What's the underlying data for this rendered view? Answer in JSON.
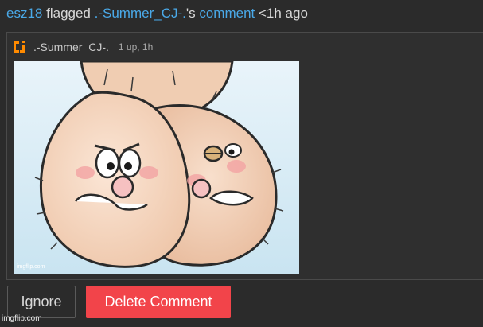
{
  "notification": {
    "actor": "esz18",
    "action": "flagged",
    "target_user": ".-Summer_CJ-.",
    "possessive": "'s",
    "object": "comment",
    "time": "<1h ago"
  },
  "comment": {
    "username": ".-Summer_CJ-.",
    "stats": "1 up, 1h",
    "image_icon": "cartoon-image",
    "image_watermark": "imgflip.com",
    "avatar_color": "#ff8a00"
  },
  "actions": {
    "ignore_label": "Ignore",
    "delete_label": "Delete Comment"
  },
  "footer": {
    "watermark": "imgflip.com"
  }
}
